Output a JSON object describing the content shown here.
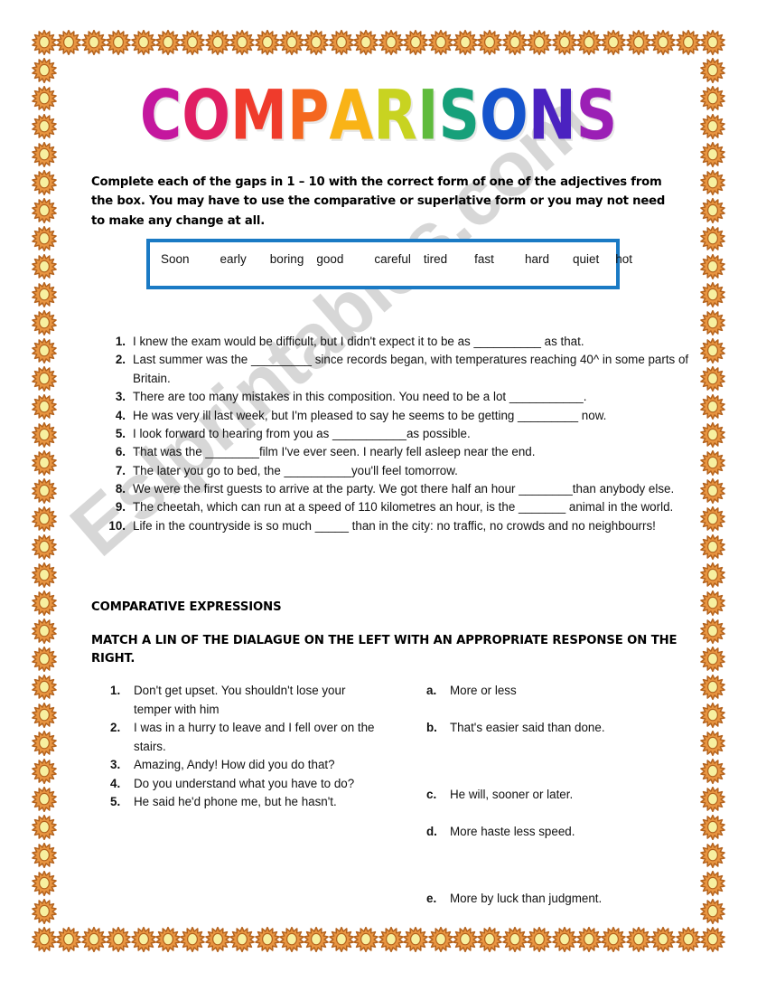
{
  "title": {
    "text": "COMPARISONS",
    "letters": [
      {
        "ch": "C",
        "color": "#c4179e"
      },
      {
        "ch": "O",
        "color": "#e01e63"
      },
      {
        "ch": "M",
        "color": "#ef3b2c"
      },
      {
        "ch": "P",
        "color": "#f4671f"
      },
      {
        "ch": "A",
        "color": "#f9b316"
      },
      {
        "ch": "R",
        "color": "#c8d321"
      },
      {
        "ch": "I",
        "color": "#5fbb3c"
      },
      {
        "ch": "S",
        "color": "#16a07a"
      },
      {
        "ch": "O",
        "color": "#1554cc"
      },
      {
        "ch": "N",
        "color": "#4b22c0"
      },
      {
        "ch": "S",
        "color": "#9b1fb5"
      }
    ]
  },
  "instructions": "Complete each of the gaps in 1 – 10 with the correct form of one of the adjectives from the box. You may have to use the comparative or superlative form or you may not need to make any change at all.",
  "word_box": {
    "border_color": "#1a7ac4",
    "words": [
      "Soon",
      "early",
      "boring",
      "good",
      "careful",
      "tired",
      "fast",
      "hard",
      "quiet",
      "hot"
    ]
  },
  "gapfill": {
    "items": [
      {
        "num": "1.",
        "text": "I knew the exam would be difficult, but I didn't expect it to be as __________ as that."
      },
      {
        "num": "2.",
        "text": "Last summer was the _________ since records began, with temperatures reaching 40^ in some parts of Britain."
      },
      {
        "num": "3.",
        "text": "There are too many mistakes in this composition. You need to be a lot ___________."
      },
      {
        "num": "4.",
        "text": "He was very ill last week, but I'm pleased to say he seems to be getting _________ now."
      },
      {
        "num": "5.",
        "text": "I look forward to hearing from you as ___________as possible."
      },
      {
        "num": "6.",
        "text": "That was the ________film I've ever seen. I nearly fell asleep near the end."
      },
      {
        "num": "7.",
        "text": "The later you go to bed, the __________you'll feel tomorrow."
      },
      {
        "num": "8.",
        "text": "We were the first guests to arrive at the party. We got there half an hour ________than anybody else."
      },
      {
        "num": "9.",
        "text": "The cheetah, which can run at a speed of 110 kilometres an hour, is the _______ animal in the world."
      },
      {
        "num": "10.",
        "text": "Life in the countryside is so much _____ than in the city: no traffic, no crowds and no neighbourrs!"
      }
    ]
  },
  "headings": {
    "comparative_expressions": "COMPARATIVE EXPRESSIONS",
    "match_instruction": "MATCH A LIN OF THE DIALAGUE ON THE LEFT WITH AN APPROPRIATE RESPONSE ON THE RIGHT."
  },
  "matching": {
    "left": [
      {
        "num": "1.",
        "text": "Don't get upset. You shouldn't lose your temper with him",
        "gap_after": 0
      },
      {
        "num": "2.",
        "text": "I was in a hurry to leave and I fell over on the stairs.",
        "gap_after": 0
      },
      {
        "num": "3.",
        "text": "Amazing, Andy! How did you do that?",
        "gap_after": 0
      },
      {
        "num": "4.",
        "text": "Do you understand what you have to do?",
        "gap_after": 0
      },
      {
        "num": "5.",
        "text": "He said he'd phone me, but he hasn't.",
        "gap_after": 0
      }
    ],
    "right": [
      {
        "num": "a.",
        "text": "More or less",
        "gap_after": 20
      },
      {
        "num": "b.",
        "text": "That's easier said than done.",
        "gap_after": 54
      },
      {
        "num": "c.",
        "text": "He will, sooner or later.",
        "gap_after": 20
      },
      {
        "num": "d.",
        "text": "More haste less speed.",
        "gap_after": 54
      },
      {
        "num": "e.",
        "text": "More by luck than judgment.",
        "gap_after": 0
      }
    ]
  },
  "watermark": {
    "text": "Eslprintables.com",
    "color": "#c9c9c9"
  },
  "border": {
    "icon": "sun-icon",
    "center_color": "#f7f0a0",
    "ray_color": "#e89541",
    "outline_color": "#b4621c",
    "count_horizontal": 28,
    "count_vertical": 33
  }
}
